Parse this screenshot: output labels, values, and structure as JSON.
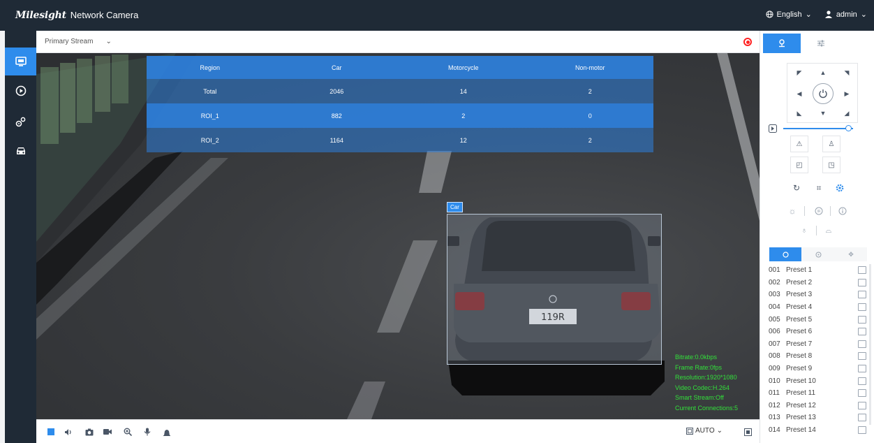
{
  "header": {
    "brand": "Milesight",
    "title": "Network Camera",
    "language": "English",
    "user": "admin"
  },
  "sidebar": {
    "items": [
      {
        "id": "live-view",
        "icon": "monitor-icon",
        "active": true
      },
      {
        "id": "playback",
        "icon": "play-circle-icon",
        "active": false
      },
      {
        "id": "settings",
        "icon": "gears-icon",
        "active": false
      },
      {
        "id": "vehicle",
        "icon": "car-icon",
        "active": false
      }
    ]
  },
  "stream": {
    "selected": "Primary Stream"
  },
  "overlay_table": {
    "headers": [
      "Region",
      "Car",
      "Motorcycle",
      "Non-motor"
    ],
    "rows": [
      [
        "Total",
        "2046",
        "14",
        "2"
      ],
      [
        "ROI_1",
        "882",
        "2",
        "0"
      ],
      [
        "ROI_2",
        "1164",
        "12",
        "2"
      ]
    ]
  },
  "detection": {
    "label": "Car",
    "plate": "119R"
  },
  "osd": {
    "lines": [
      "Bitrate:0.0kbps",
      "Frame Rate:0fps",
      "Resolution:1920*1080",
      "Video Codec:H.264",
      "Smart Stream:Off",
      "Current Connections:5"
    ]
  },
  "toolbar": {
    "zoom_mode": "AUTO"
  },
  "colors": {
    "topbar": "#1f2a36",
    "accent": "#2e8cec",
    "osd_text": "#32e03a",
    "record": "#ff2222"
  },
  "presets": [
    {
      "num": "001",
      "name": "Preset 1"
    },
    {
      "num": "002",
      "name": "Preset 2"
    },
    {
      "num": "003",
      "name": "Preset 3"
    },
    {
      "num": "004",
      "name": "Preset 4"
    },
    {
      "num": "005",
      "name": "Preset 5"
    },
    {
      "num": "006",
      "name": "Preset 6"
    },
    {
      "num": "007",
      "name": "Preset 7"
    },
    {
      "num": "008",
      "name": "Preset 8"
    },
    {
      "num": "009",
      "name": "Preset 9"
    },
    {
      "num": "010",
      "name": "Preset 10"
    },
    {
      "num": "011",
      "name": "Preset 11"
    },
    {
      "num": "012",
      "name": "Preset 12"
    },
    {
      "num": "013",
      "name": "Preset 13"
    },
    {
      "num": "014",
      "name": "Preset 14"
    }
  ]
}
